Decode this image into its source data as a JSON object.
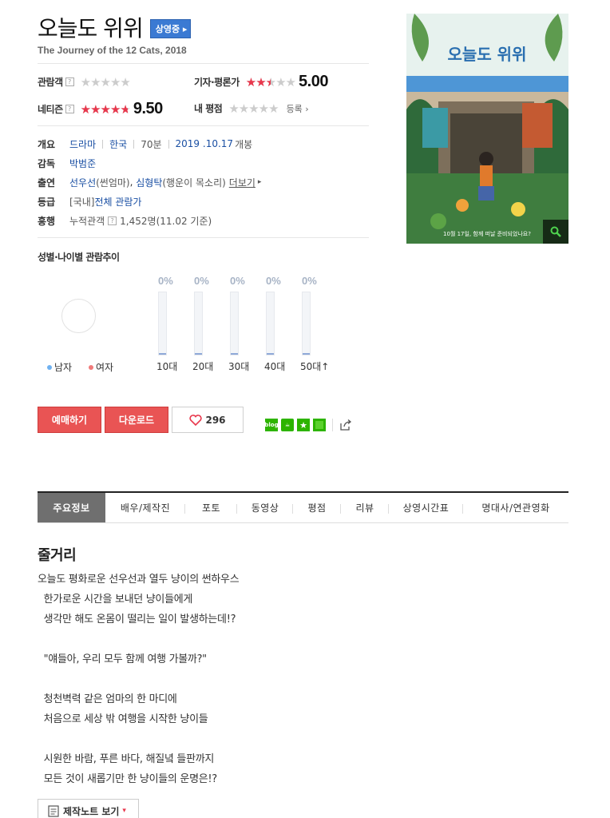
{
  "movie": {
    "title": "오늘도 위위",
    "status_badge": "상영중",
    "subtitle": "The Journey of the 12 Cats, 2018"
  },
  "ratings": {
    "audience": {
      "label": "관람객",
      "help": "?",
      "score_fraction": 0
    },
    "critic": {
      "label": "기자·평론가",
      "score": "5.00",
      "score_fraction": 0.5
    },
    "netizen": {
      "label": "네티즌",
      "help": "?",
      "score": "9.50",
      "score_fraction": 0.95
    },
    "mine": {
      "label": "내 평점",
      "score_fraction": 0,
      "register_label": "등록"
    }
  },
  "info": {
    "overview_label": "개요",
    "genre": "드라마",
    "country": "한국",
    "runtime": "70분",
    "release_date": "2019 .10.17",
    "release_suffix": "개봉",
    "director_label": "감독",
    "director": "박범준",
    "cast_label": "출연",
    "cast1": "선우선",
    "cast1_role": "(썬엄마)",
    "cast2": "심형탁",
    "cast2_role": "(행운이 목소리)",
    "more_label": "더보기",
    "grade_label": "등급",
    "grade_prefix": "[국내]",
    "grade": "전체 관람가",
    "box_label": "흥행",
    "box_text": "누적관객",
    "box_value": "1,452명(11.02 기준)"
  },
  "chart": {
    "title": "성별·나이별 관람추이",
    "legend_male": "남자",
    "legend_female": "여자",
    "male_color": "#6fb1f0",
    "female_color": "#f07a7a"
  },
  "chart_data": {
    "type": "bar",
    "title": "성별·나이별 관람추이",
    "categories": [
      "10대",
      "20대",
      "30대",
      "40대",
      "50대↑"
    ],
    "values": [
      0,
      0,
      0,
      0,
      0
    ],
    "value_labels": [
      "0%",
      "0%",
      "0%",
      "0%",
      "0%"
    ],
    "ylim": [
      0,
      100
    ]
  },
  "actions": {
    "reserve_label": "예매하기",
    "download_label": "다운로드",
    "like_count": "296",
    "share_icons": [
      "blog-icon",
      "cafe-icon",
      "star-icon",
      "green-square-icon",
      "share-icon"
    ]
  },
  "tabs": [
    {
      "label": "주요정보",
      "active": true
    },
    {
      "label": "배우/제작진"
    },
    {
      "label": "포토"
    },
    {
      "label": "동영상"
    },
    {
      "label": "평점"
    },
    {
      "label": "리뷰"
    },
    {
      "label": "상영시간표"
    },
    {
      "label": "명대사/연관영화"
    }
  ],
  "synopsis": {
    "title": "줄거리",
    "lines": [
      "오늘도 평화로운 선우선과 열두 냥이의 썬하우스",
      "  한가로운 시간을 보내던 냥이들에게",
      "  생각만 해도 온몸이 떨리는 일이 발생하는데!?",
      "",
      "  \"얘들아, 우리 모두 함께 여행 가볼까?\"",
      "",
      "  청천벽력 같은 엄마의 한 마디에",
      "  처음으로 세상 밖 여행을 시작한 냥이들",
      "",
      "  시원한 바람, 푸른 바다, 해질녘 들판까지",
      "  모든 것이 새롭기만 한 냥이들의 운명은!?"
    ],
    "note_button": "제작노트 보기"
  },
  "poster": {
    "title_text": "오늘도 위위",
    "caption": "10월 17일, 함께 떠날 준비되었나요?"
  },
  "colors": {
    "accent_red": "#e95454",
    "badge_blue": "#3b7ad3",
    "link_blue": "#1a4fa3",
    "star_red": "#e8374c"
  }
}
